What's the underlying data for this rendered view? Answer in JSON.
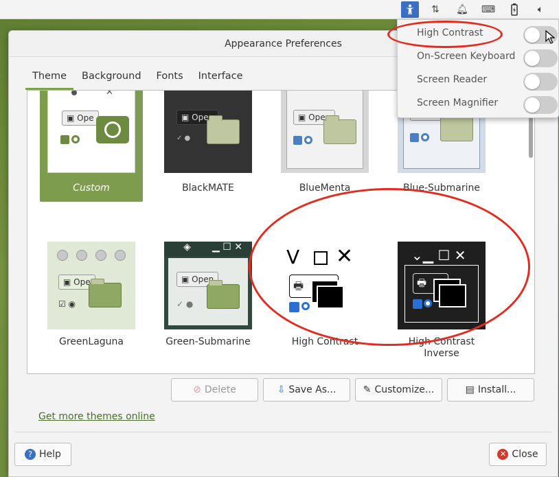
{
  "window": {
    "title": "Appearance Preferences"
  },
  "tabs": [
    {
      "label": "Theme"
    },
    {
      "label": "Background"
    },
    {
      "label": "Fonts"
    },
    {
      "label": "Interface"
    }
  ],
  "themes": [
    {
      "label": "Custom",
      "selected": true
    },
    {
      "label": "BlackMATE"
    },
    {
      "label": "BlueMenta"
    },
    {
      "label": "Blue-Submarine"
    },
    {
      "label": "GreenLaguna"
    },
    {
      "label": "Green-Submarine"
    },
    {
      "label": "High Contrast"
    },
    {
      "label": "High Contrast Inverse"
    }
  ],
  "thumb_text": {
    "open": "Open",
    "open_short": "Ope"
  },
  "buttons": {
    "delete": "Delete",
    "save_as": "Save As...",
    "customize": "Customize...",
    "install": "Install...",
    "help": "Help",
    "close": "Close"
  },
  "get_more_link": "Get more themes online",
  "accessibility_menu": {
    "items": [
      {
        "label": "High Contrast",
        "on": false
      },
      {
        "label": "On-Screen Keyboard",
        "on": false
      },
      {
        "label": "Screen Reader",
        "on": false
      },
      {
        "label": "Screen Magnifier",
        "on": false
      }
    ]
  },
  "tray_icons": [
    "accessibility-icon",
    "network-icon",
    "notifications-icon",
    "keyboard-icon",
    "battery-icon",
    "volume-icon"
  ],
  "colors": {
    "accent": "#7e9c4d",
    "annotation": "#e32b1e"
  }
}
